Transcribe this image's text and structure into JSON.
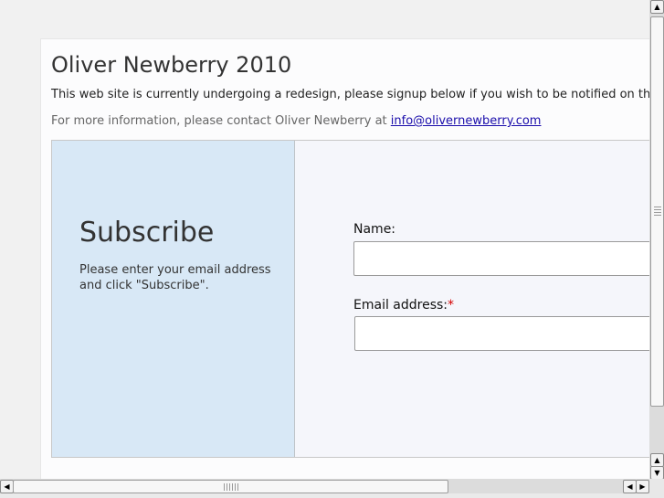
{
  "page": {
    "title": "Oliver Newberry 2010",
    "notice": "This web site is currently undergoing a redesign, please signup below if you wish to be notified on the launch",
    "contact_prefix": "For more information, please contact Oliver Newberry at ",
    "contact_email": "info@olivernewberry.com"
  },
  "subscribe": {
    "heading": "Subscribe",
    "description": "Please enter your email address and click \"Subscribe\"."
  },
  "form": {
    "name_label": "Name:",
    "name_value": "",
    "email_label": "Email address:",
    "required_marker": "*",
    "email_value": ""
  },
  "scrollbars": {
    "up_arrow": "▲",
    "down_arrow": "▼",
    "left_arrow": "◀",
    "right_arrow": "▶"
  }
}
